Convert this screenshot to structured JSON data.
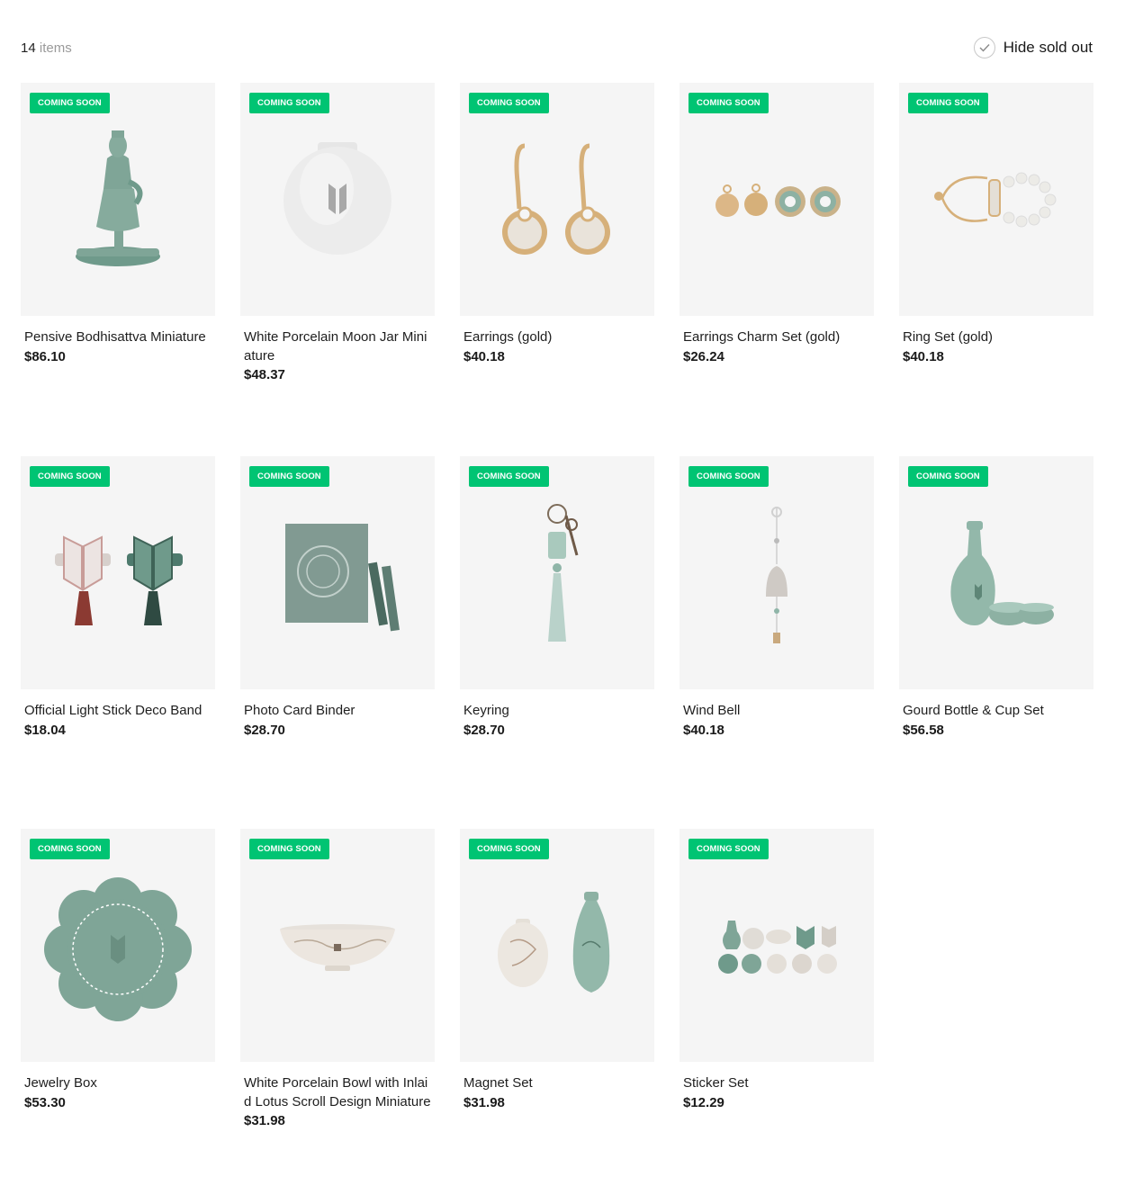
{
  "header": {
    "count_number": "14",
    "count_unit": "items",
    "hide_sold_out_label": "Hide sold out"
  },
  "colors": {
    "badge": "#00c473",
    "thumb_bg": "#f5f5f5",
    "celadon": "#7fa597",
    "gold": "#d6b07a"
  },
  "products": [
    {
      "badge": "COMING SOON",
      "name": "Pensive Bodhisattva Miniature",
      "price": "$86.10",
      "icon": "bodhisattva-figure"
    },
    {
      "badge": "COMING SOON",
      "name": "White Porcelain Moon Jar Miniature",
      "price": "$48.37",
      "icon": "moon-jar"
    },
    {
      "badge": "COMING SOON",
      "name": "Earrings (gold)",
      "price": "$40.18",
      "icon": "earrings"
    },
    {
      "badge": "COMING SOON",
      "name": "Earrings Charm Set (gold)",
      "price": "$26.24",
      "icon": "charm-set"
    },
    {
      "badge": "COMING SOON",
      "name": "Ring Set (gold)",
      "price": "$40.18",
      "icon": "ring-set"
    },
    {
      "badge": "COMING SOON",
      "name": "Official Light Stick Deco Band",
      "price": "$18.04",
      "icon": "deco-band"
    },
    {
      "badge": "COMING SOON",
      "name": "Photo Card Binder",
      "price": "$28.70",
      "icon": "binder"
    },
    {
      "badge": "COMING SOON",
      "name": "Keyring",
      "price": "$28.70",
      "icon": "keyring"
    },
    {
      "badge": "COMING SOON",
      "name": "Wind Bell",
      "price": "$40.18",
      "icon": "wind-bell"
    },
    {
      "badge": "COMING SOON",
      "name": "Gourd Bottle & Cup Set",
      "price": "$56.58",
      "icon": "gourd-bottle"
    },
    {
      "badge": "COMING SOON",
      "name": "Jewelry Box",
      "price": "$53.30",
      "icon": "jewelry-box"
    },
    {
      "badge": "COMING SOON",
      "name": "White Porcelain Bowl with Inlaid Lotus Scroll Design Miniature",
      "price": "$31.98",
      "icon": "bowl"
    },
    {
      "badge": "COMING SOON",
      "name": "Magnet Set",
      "price": "$31.98",
      "icon": "magnet-set"
    },
    {
      "badge": "COMING SOON",
      "name": "Sticker Set",
      "price": "$12.29",
      "icon": "sticker-set"
    }
  ]
}
